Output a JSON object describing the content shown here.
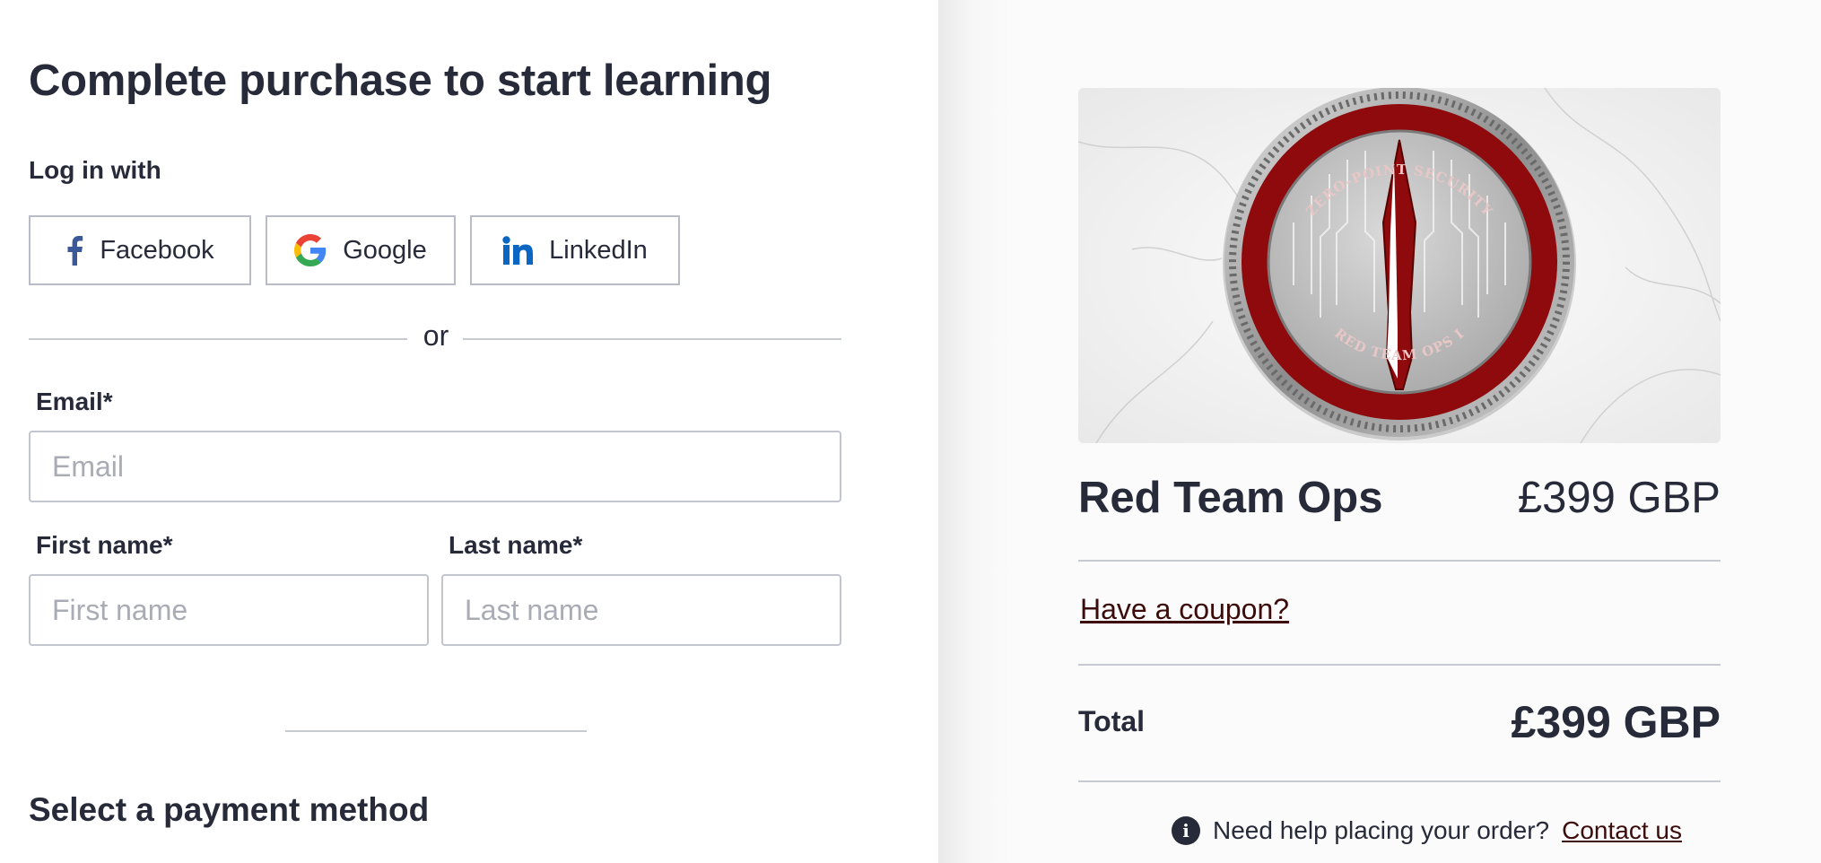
{
  "checkout": {
    "title": "Complete purchase to start learning",
    "login_label": "Log in with",
    "social": {
      "facebook": "Facebook",
      "google": "Google",
      "linkedin": "LinkedIn"
    },
    "or_text": "or",
    "email": {
      "label": "Email*",
      "placeholder": "Email",
      "value": ""
    },
    "first_name": {
      "label": "First name*",
      "placeholder": "First name",
      "value": ""
    },
    "last_name": {
      "label": "Last name*",
      "placeholder": "Last name",
      "value": ""
    },
    "payment_title": "Select a payment method"
  },
  "order": {
    "image_text_top": "ZERO-POINT SECURITY",
    "image_text_bottom": "RED TEAM OPS I",
    "product_name": "Red Team Ops",
    "product_price": "£399 GBP",
    "coupon_link": "Have a coupon?",
    "total_label": "Total",
    "total_amount": "£399 GBP",
    "help_text": "Need help placing your order?",
    "contact_link": "Contact us"
  },
  "colors": {
    "text": "#262a39",
    "link_dark_red": "#3c0b0b",
    "facebook": "#3b5998",
    "linkedin": "#0a66c2",
    "coin_red": "#8e0a0c"
  },
  "icons": [
    "facebook-icon",
    "google-icon",
    "linkedin-icon",
    "info-icon"
  ]
}
